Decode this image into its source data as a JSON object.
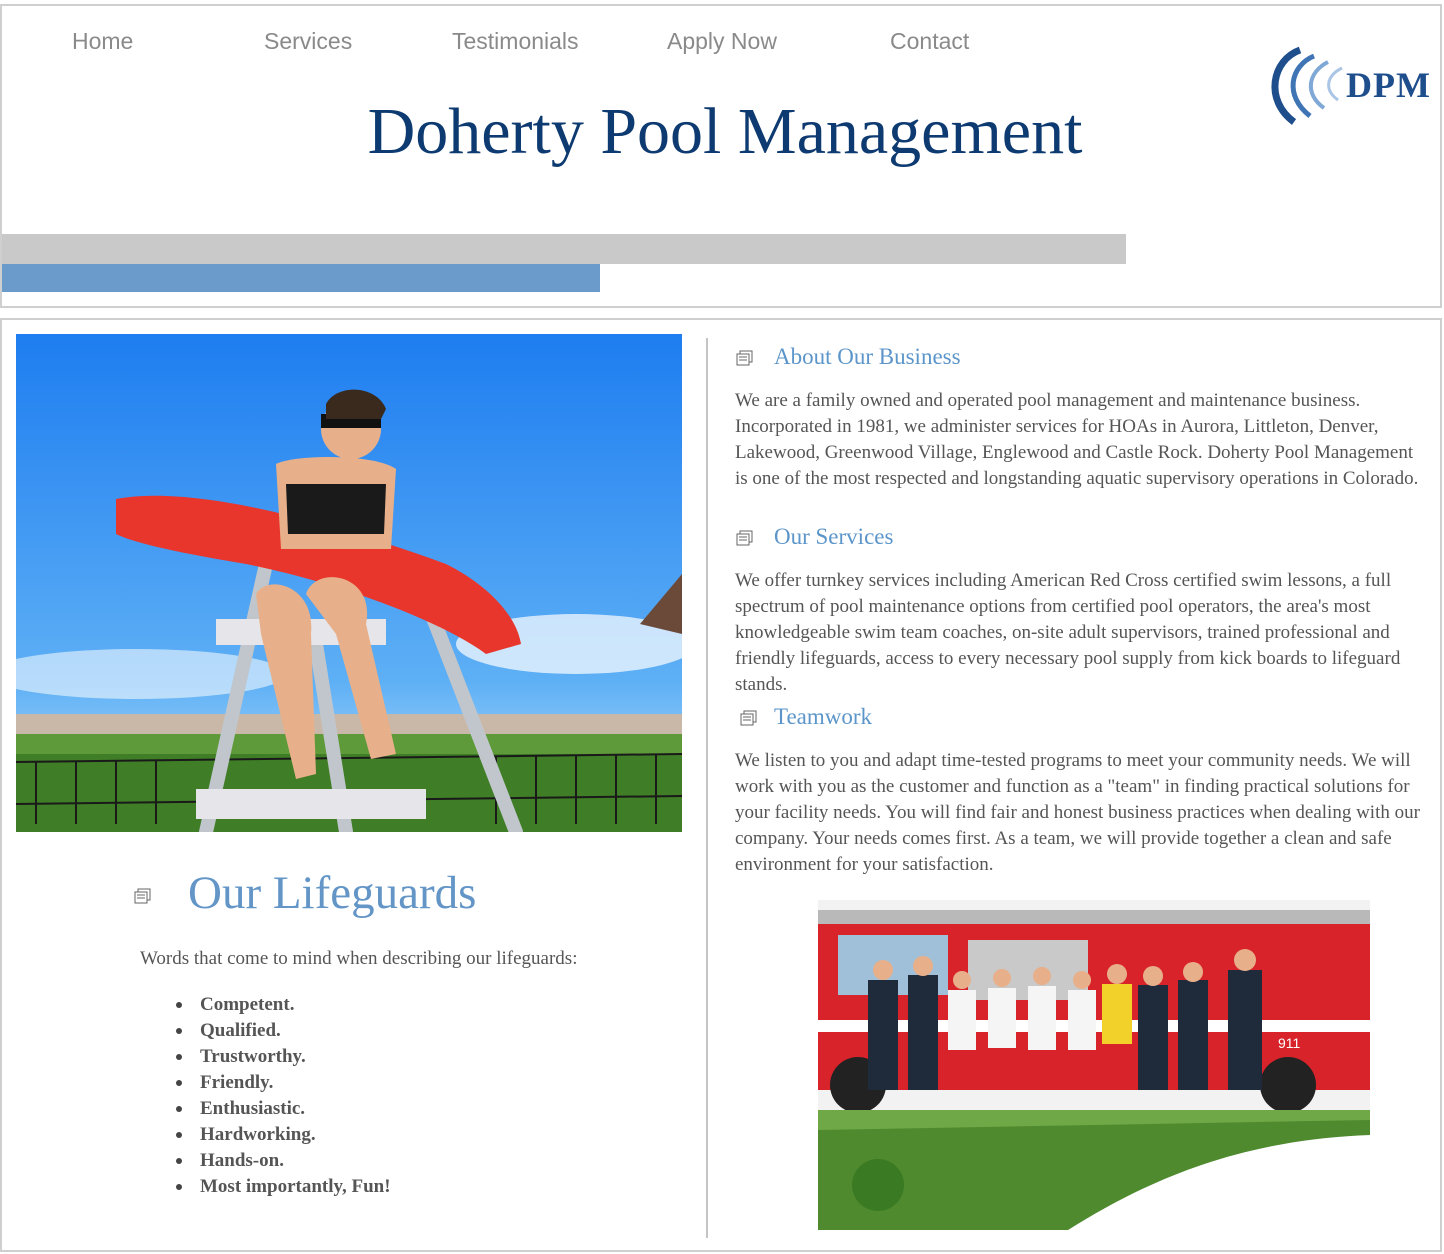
{
  "nav": {
    "items": [
      {
        "label": "Home"
      },
      {
        "label": "Services"
      },
      {
        "label": "Testimonials"
      },
      {
        "label": "Apply Now"
      },
      {
        "label": "Contact"
      }
    ]
  },
  "logo": {
    "text": "DPM"
  },
  "header": {
    "title": "Doherty Pool Management"
  },
  "left": {
    "lifeguard_image": {
      "description_icon": "lifeguard-photo"
    },
    "title": "Our Lifeguards",
    "intro": "Words that come to mind when describing our lifeguards:",
    "traits": [
      "Competent.",
      "Qualified.",
      "Trustworthy.",
      "Friendly.",
      "Enthusiastic.",
      "Hardworking.",
      "Hands-on.",
      "Most importantly, Fun!"
    ]
  },
  "right": {
    "sections": [
      {
        "heading": "About Our Business",
        "body": "We are a family owned and operated pool management and maintenance business. Incorporated in 1981, we administer services for HOAs in Aurora, Littleton, Denver, Lakewood, Greenwood Village, Englewood and Castle Rock. Doherty Pool Management is one of the most respected and longstanding aquatic supervisory operations in Colorado."
      },
      {
        "heading": "Our Services",
        "body": "We offer turnkey services including American Red Cross certified swim lessons, a full spectrum of pool maintenance options from certified pool operators, the area's most knowledgeable swim team coaches, on-site adult supervisors, trained professional and friendly lifeguards, access to every necessary pool supply from kick boards to lifeguard stands."
      },
      {
        "heading": "Teamwork",
        "body": "We listen to you and adapt time-tested programs to meet your community needs. We will work with you as the customer and function as a \"team\" in finding practical solutions for your facility needs. You will find fair and honest business practices when dealing with our company. Your needs comes first. As a team, we will provide together a clean and safe environment for your satisfaction."
      }
    ],
    "truck_image_label": "911"
  },
  "colors": {
    "title": "#0d3a70",
    "accent": "#6396c7",
    "nav": "#8a8a8a",
    "bar_gray": "#c9c9c9",
    "bar_blue": "#6b9bcb"
  }
}
